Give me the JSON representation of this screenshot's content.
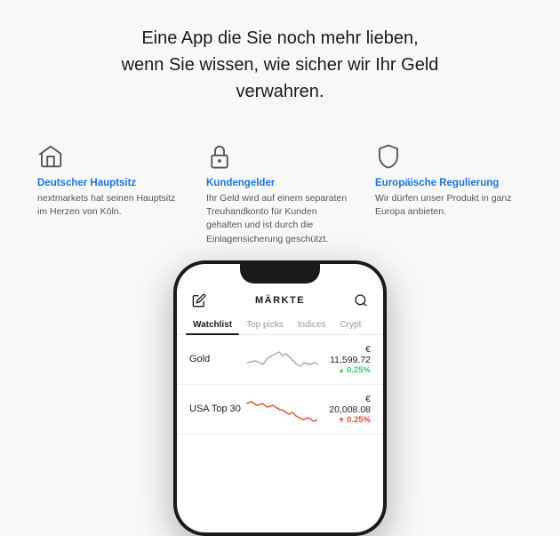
{
  "hero": {
    "line1": "Eine App die Sie noch mehr lieben,",
    "line2": "wenn Sie wissen, wie sicher wir Ihr Geld",
    "line3": "verwahren."
  },
  "features": [
    {
      "id": "hauptsitz",
      "icon": "home",
      "title": "Deutscher Hauptsitz",
      "desc": "nextmarkets hat seinen Hauptsitz im Herzen von Köln."
    },
    {
      "id": "kundengelder",
      "icon": "lock",
      "title": "Kundengelder",
      "desc": "Ihr Geld wird auf einem separaten Treuhandkonto für Kunden gehalten und ist durch die Einlagensicherung geschützt."
    },
    {
      "id": "regulierung",
      "icon": "shield",
      "title": "Europäische Regulierung",
      "desc": "Wir dürfen unser Produkt in ganz Europa anbieten."
    }
  ],
  "phone": {
    "topbar": {
      "title": "MÄRKTE",
      "left_icon": "edit-icon",
      "right_icon": "search-icon"
    },
    "tabs": [
      {
        "id": "watchlist",
        "label": "Watchlist",
        "active": true
      },
      {
        "id": "top-picks",
        "label": "Top picks",
        "active": false
      },
      {
        "id": "indices",
        "label": "Indices",
        "active": false
      },
      {
        "id": "crypto",
        "label": "Crypt",
        "active": false
      }
    ],
    "stocks": [
      {
        "name": "Gold",
        "price": "€ 11,599.72",
        "change": "0.25%",
        "direction": "up",
        "chart_type": "gold"
      },
      {
        "name": "USA Top 30",
        "price": "€ 20,008.08",
        "change": "0.25%",
        "direction": "down",
        "chart_type": "usa"
      }
    ]
  }
}
